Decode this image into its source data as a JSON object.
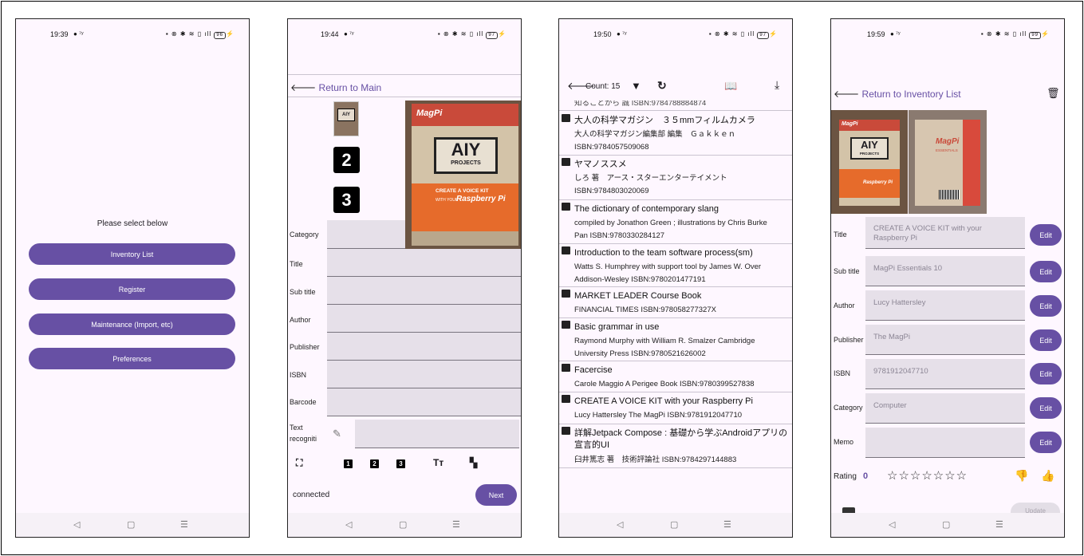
{
  "common": {
    "nav_back": "◁",
    "nav_home": "▢",
    "nav_recents": "☰"
  },
  "screens": [
    {
      "time": "19:39",
      "battery": "96",
      "prompt": "Please select below",
      "buttons": [
        "Inventory List",
        "Register",
        "Maintenance (Import, etc)",
        "Preferences"
      ]
    },
    {
      "time": "19:44",
      "battery": "97",
      "return_label": "Return to Main",
      "labels": [
        "Category",
        "Title",
        "Sub title",
        "Author",
        "Publisher",
        "ISBN",
        "Barcode",
        "Text recogniti"
      ],
      "thumb_numbers": [
        "2",
        "3"
      ],
      "toolbar_numbers": [
        "1",
        "2",
        "3"
      ],
      "toolbar_text_icon": "Tт",
      "book_cover": {
        "brand": "MagPi",
        "title": "AIY",
        "subtitle": "PROJECTS",
        "tagline": "CREATE A VOICE KIT",
        "with": "WITH YOUR",
        "product": "Raspberry Pi"
      },
      "status": "connected",
      "next_label": "Next"
    },
    {
      "time": "19:50",
      "battery": "97",
      "count_label": "Count: 15",
      "partial_top": "知ることから    誠 ISBN:9784788884874",
      "items": [
        {
          "title": "大人の科学マガジン　３５mmフィルムカメラ",
          "lines": [
            "大人の科学マガジン編集部 編集　Ｇａｋｋｅｎ",
            "ISBN:9784057509068"
          ]
        },
        {
          "title": "ヤマノススメ",
          "lines": [
            "しろ 著　アース・スターエンターテイメント",
            "ISBN:9784803020069"
          ]
        },
        {
          "title": "The dictionary of contemporary slang",
          "lines": [
            "compiled by Jonathon Green ; illustrations by Chris Burke",
            "Pan ISBN:9780330284127"
          ]
        },
        {
          "title": "Introduction to the team software process(sm)",
          "lines": [
            "Watts S. Humphrey with support tool by James W. Over",
            "Addison-Wesley ISBN:9780201477191"
          ]
        },
        {
          "title": "MARKET LEADER Course Book",
          "lines": [
            "   FINANCIAL TIMES ISBN:978058277327X"
          ]
        },
        {
          "title": "Basic grammar in use",
          "lines": [
            "Raymond Murphy with William R. Smalzer   Cambridge",
            "University Press ISBN:9780521626002"
          ]
        },
        {
          "title": "Facercise",
          "lines": [
            "Carole Maggio   A  Perigee Book ISBN:9780399527838"
          ]
        },
        {
          "title": "CREATE A VOICE KIT with your Raspberry Pi",
          "lines": [
            "Lucy Hattersley   The MagPi ISBN:9781912047710"
          ]
        },
        {
          "title": "詳解Jetpack Compose : 基礎から学ぶAndroidアプリの宣言的UI",
          "lines": [
            "臼井篤志 著　技術評論社 ISBN:9784297144883"
          ]
        }
      ]
    },
    {
      "time": "19:59",
      "battery": "99",
      "return_label": "Return to Inventory List",
      "book_cover": {
        "brand": "MagPi",
        "title": "AIY",
        "subtitle": "PROJECTS",
        "product": "Raspberry Pi",
        "back_brand": "MagPi",
        "back_subtitle": "ESSENTIALS"
      },
      "fields": [
        {
          "label": "Title",
          "value": "CREATE A VOICE KIT with your Raspberry Pi"
        },
        {
          "label": "Sub title",
          "value": "MagPi Essentials 10"
        },
        {
          "label": "Author",
          "value": "Lucy Hattersley"
        },
        {
          "label": "Publisher",
          "value": "The MagPi"
        },
        {
          "label": "ISBN",
          "value": "9781912047710"
        },
        {
          "label": "Category",
          "value": "Computer"
        },
        {
          "label": "Memo",
          "value": ""
        }
      ],
      "edit_label": "Edit",
      "rating_label": "Rating",
      "rating_value": "0",
      "stars": "☆☆☆☆☆☆☆",
      "update_label": "Update"
    }
  ],
  "colors": {
    "accent": "#6750a4",
    "background": "#fef7ff",
    "field": "#e6e0e9"
  }
}
